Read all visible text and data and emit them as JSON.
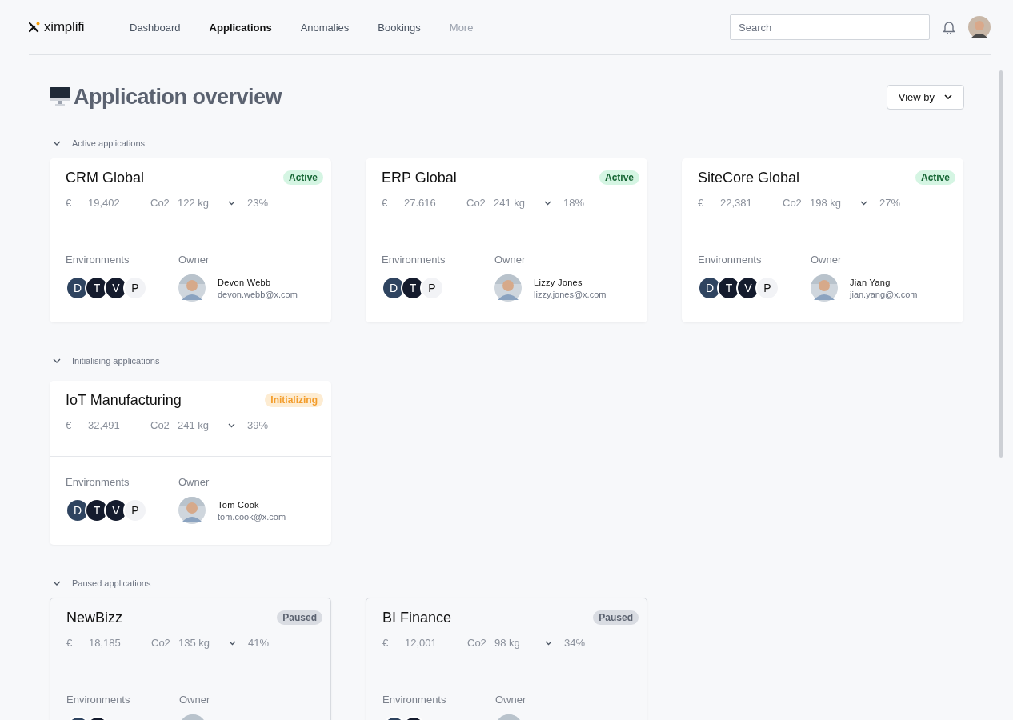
{
  "header": {
    "logo": "ximplifi",
    "nav": [
      {
        "label": "Dashboard",
        "selected": false,
        "disabled": false
      },
      {
        "label": "Applications",
        "selected": true,
        "disabled": false
      },
      {
        "label": "Anomalies",
        "selected": false,
        "disabled": false
      },
      {
        "label": "Bookings",
        "selected": false,
        "disabled": false
      },
      {
        "label": "More",
        "selected": false,
        "disabled": true
      }
    ],
    "search": {
      "placeholder": "Search"
    }
  },
  "page": {
    "title": "Application overview",
    "view_by": "View by"
  },
  "sections": [
    {
      "label": "Active applications",
      "expanded": true,
      "cards": [
        {
          "name": "CRM Global",
          "status": {
            "label": "Active",
            "kind": "active"
          },
          "currency": "€",
          "cost": "19,402",
          "co2_label": "Co2",
          "co2": "122 kg",
          "change": "23%",
          "env_label": "Environments",
          "owner_label": "Owner",
          "environments": [
            {
              "letter": "D",
              "color": "#2f4460"
            },
            {
              "letter": "T",
              "color": "#141b2d"
            },
            {
              "letter": "V",
              "color": "#141b2d"
            },
            {
              "letter": "P",
              "color": "#f2f3f6"
            }
          ],
          "owner": {
            "kind": "person",
            "name": "Devon Webb",
            "email": "devon.webb@x.com"
          }
        },
        {
          "name": "ERP Global",
          "status": {
            "label": "Active",
            "kind": "active"
          },
          "currency": "€",
          "cost": "27.616",
          "co2_label": "Co2",
          "co2": "241 kg",
          "change": "18%",
          "env_label": "Environments",
          "owner_label": "Owner",
          "environments": [
            {
              "letter": "D",
              "color": "#2f4460"
            },
            {
              "letter": "T",
              "color": "#141b2d"
            },
            {
              "letter": "P",
              "color": "#f2f3f6"
            }
          ],
          "owner": {
            "kind": "person",
            "name": "Lizzy Jones",
            "email": "lizzy.jones@x.com"
          }
        },
        {
          "name": "SiteCore Global",
          "status": {
            "label": "Active",
            "kind": "active"
          },
          "currency": "€",
          "cost": "22,381",
          "co2_label": "Co2",
          "co2": "198 kg",
          "change": "27%",
          "env_label": "Environments",
          "owner_label": "Owner",
          "environments": [
            {
              "letter": "D",
              "color": "#2f4460"
            },
            {
              "letter": "T",
              "color": "#141b2d"
            },
            {
              "letter": "V",
              "color": "#141b2d"
            },
            {
              "letter": "P",
              "color": "#f2f3f6"
            }
          ],
          "owner": {
            "kind": "person",
            "name": "Jian Yang",
            "email": "jian.yang@x.com"
          }
        }
      ]
    },
    {
      "label": "Initialising applications",
      "expanded": true,
      "cards": [
        {
          "name": "IoT Manufacturing",
          "status": {
            "label": "Initializing",
            "kind": "initializing"
          },
          "currency": "€",
          "cost": "32,491",
          "co2_label": "Co2",
          "co2": "241 kg",
          "change": "39%",
          "env_label": "Environments",
          "owner_label": "Owner",
          "environments": [
            {
              "letter": "D",
              "color": "#2f4460"
            },
            {
              "letter": "T",
              "color": "#141b2d"
            },
            {
              "letter": "V",
              "color": "#141b2d"
            },
            {
              "letter": "P",
              "color": "#f2f3f6"
            }
          ],
          "owner": {
            "kind": "person",
            "name": "Tom Cook",
            "email": "tom.cook@x.com"
          }
        }
      ]
    },
    {
      "label": "Paused applications",
      "expanded": true,
      "cards": [
        {
          "name": "NewBizz",
          "status": {
            "label": "Paused",
            "kind": "paused"
          },
          "currency": "€",
          "cost": "18,185",
          "co2_label": "Co2",
          "co2": "135 kg",
          "change": "41%",
          "env_label": "Environments",
          "owner_label": "Owner",
          "environments": [
            {
              "color": "#2f4460"
            },
            {
              "color": "#141b2d"
            }
          ],
          "owner": {
            "kind": "photo_only"
          }
        },
        {
          "name": "BI Finance",
          "status": {
            "label": "Paused",
            "kind": "paused"
          },
          "currency": "€",
          "cost": "12,001",
          "co2_label": "Co2",
          "co2": "98 kg",
          "change": "34%",
          "env_label": "Environments",
          "owner_label": "Owner",
          "environments": [
            {
              "color": "#2f4460"
            },
            {
              "color": "#141b2d"
            }
          ],
          "owner": {
            "kind": "photo_only"
          }
        }
      ]
    }
  ]
}
